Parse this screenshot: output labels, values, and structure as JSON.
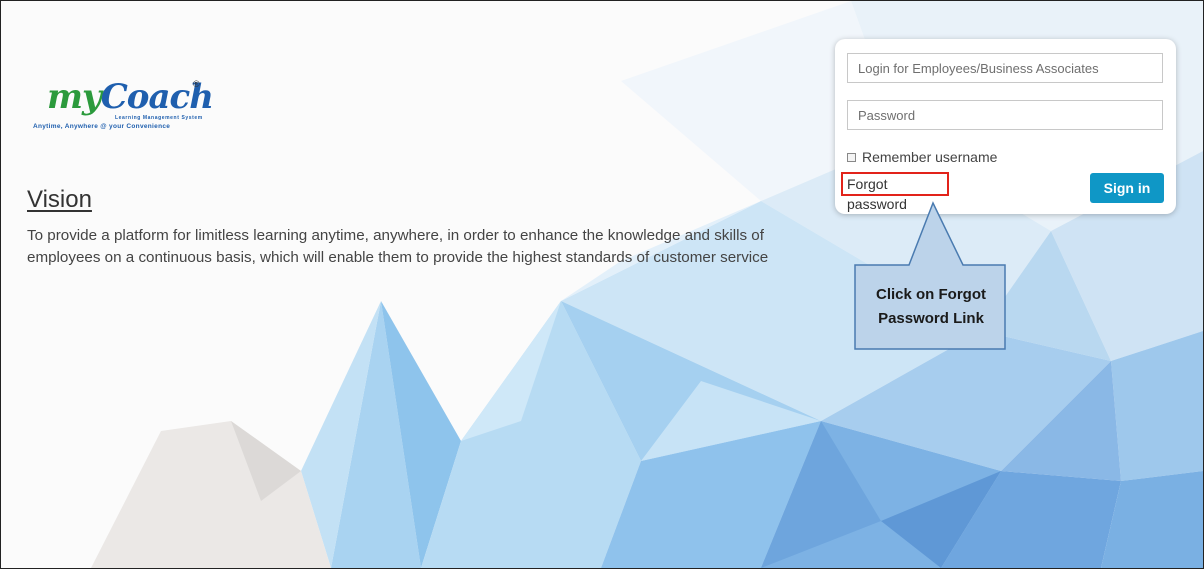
{
  "logo": {
    "brand_prefix": "my",
    "brand_main": "Coach",
    "registered": "®",
    "subtitle": "Learning Management System",
    "tagline": "Anytime, Anywhere @ your Convenience"
  },
  "vision": {
    "title": "Vision",
    "line1": "To provide a platform for limitless learning anytime, anywhere, in order to enhance the knowledge and skills of",
    "line2": "employees on a continuous basis, which will enable them to provide the highest standards of customer service"
  },
  "login": {
    "username_placeholder": "Login for Employees/Business Associates",
    "username_value": "",
    "password_placeholder": "Password",
    "password_value": "",
    "remember_label": "Remember username",
    "remember_checked": false,
    "forgot_label": "Forgot password",
    "signin_label": "Sign in"
  },
  "callout": {
    "line1": "Click on Forgot",
    "line2": "Password Link"
  },
  "colors": {
    "brand_green": "#2b9a3c",
    "brand_blue": "#1f5fae",
    "signin_button": "#0f97c6",
    "highlight_border": "#e2231a",
    "callout_fill": "#bcd3ea",
    "callout_border": "#4a7bb0"
  }
}
